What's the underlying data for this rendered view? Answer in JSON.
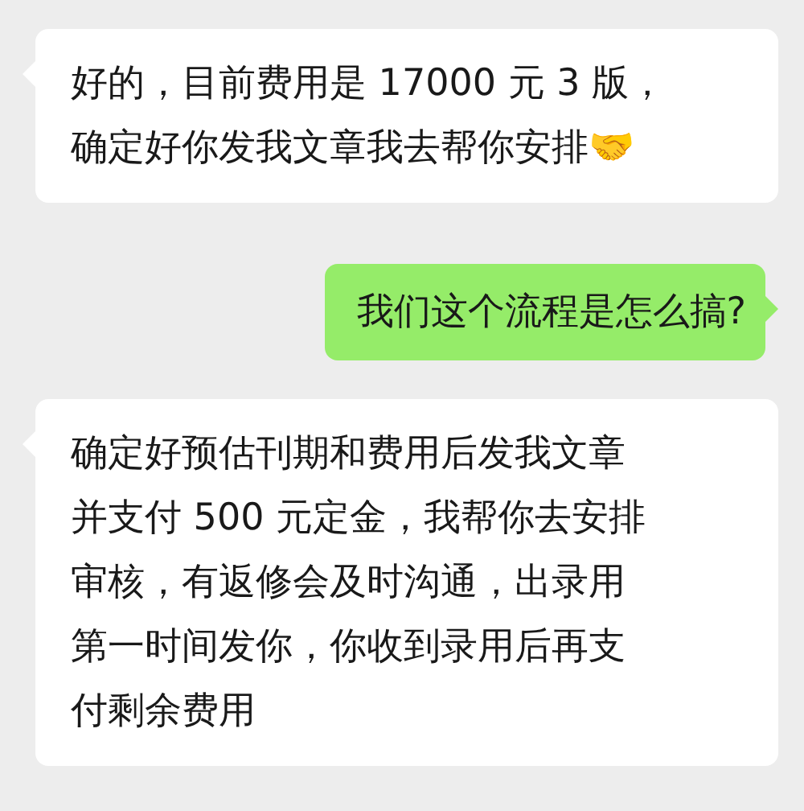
{
  "messages": [
    {
      "kind": "received",
      "lines": [
        "好的，目前费用是 17000 元 3 版，",
        "确定好你发我文章我去帮你安排🤝"
      ]
    },
    {
      "kind": "sent",
      "lines": [
        "我们这个流程是怎么搞?"
      ]
    },
    {
      "kind": "received",
      "lines": [
        "确定好预估刊期和费用后发我文章",
        "并支付 500 元定金，我帮你去安排",
        "审核，有返修会及时沟通，出录用",
        "第一时间发你，你收到录用后再支",
        "付剩余费用"
      ]
    }
  ]
}
